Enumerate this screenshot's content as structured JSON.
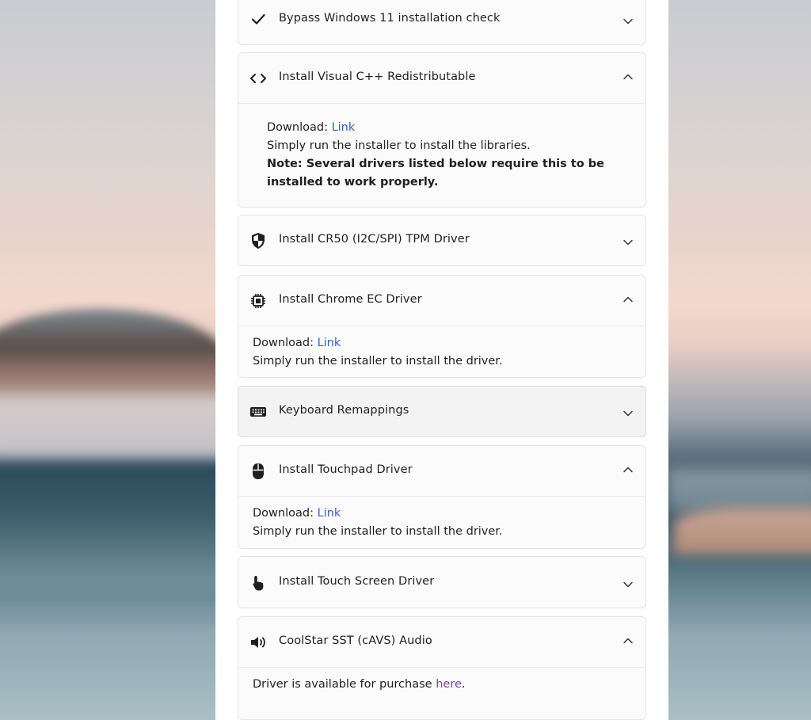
{
  "items": [
    {
      "title": "Bypass Windows 11 installation check",
      "icon": "check-icon",
      "expanded": false
    },
    {
      "title": "Install Visual C++ Redistributable",
      "icon": "code-icon",
      "expanded": true,
      "download_label": "Download:",
      "link_text": "Link",
      "description": "Simply run the installer to install the libraries.",
      "note": "Note: Several drivers listed below require this to be installed to work properly."
    },
    {
      "title": "Install CR50 (I2C/SPI) TPM Driver",
      "icon": "shield-icon",
      "expanded": false
    },
    {
      "title": "Install Chrome EC Driver",
      "icon": "chip-icon",
      "expanded": true,
      "download_label": "Download:",
      "link_text": "Link",
      "description": "Simply run the installer to install the driver."
    },
    {
      "title": "Keyboard Remappings",
      "icon": "keyboard-icon",
      "expanded": false
    },
    {
      "title": "Install Touchpad Driver",
      "icon": "mouse-icon",
      "expanded": true,
      "download_label": "Download:",
      "link_text": "Link",
      "description": "Simply run the installer to install the driver."
    },
    {
      "title": "Install Touch Screen Driver",
      "icon": "touch-hand-icon",
      "expanded": false
    },
    {
      "title": "CoolStar SST (cAVS) Audio",
      "icon": "speaker-icon",
      "expanded": true,
      "purchase_text": "Driver is available for purchase ",
      "purchase_link": "here",
      "purchase_suffix": "."
    }
  ],
  "colors": {
    "link": "#2f5fd8",
    "visited_link": "#7a3fb0",
    "card_border": "#e6e3e6",
    "card_bg": "#fcfbfc"
  }
}
